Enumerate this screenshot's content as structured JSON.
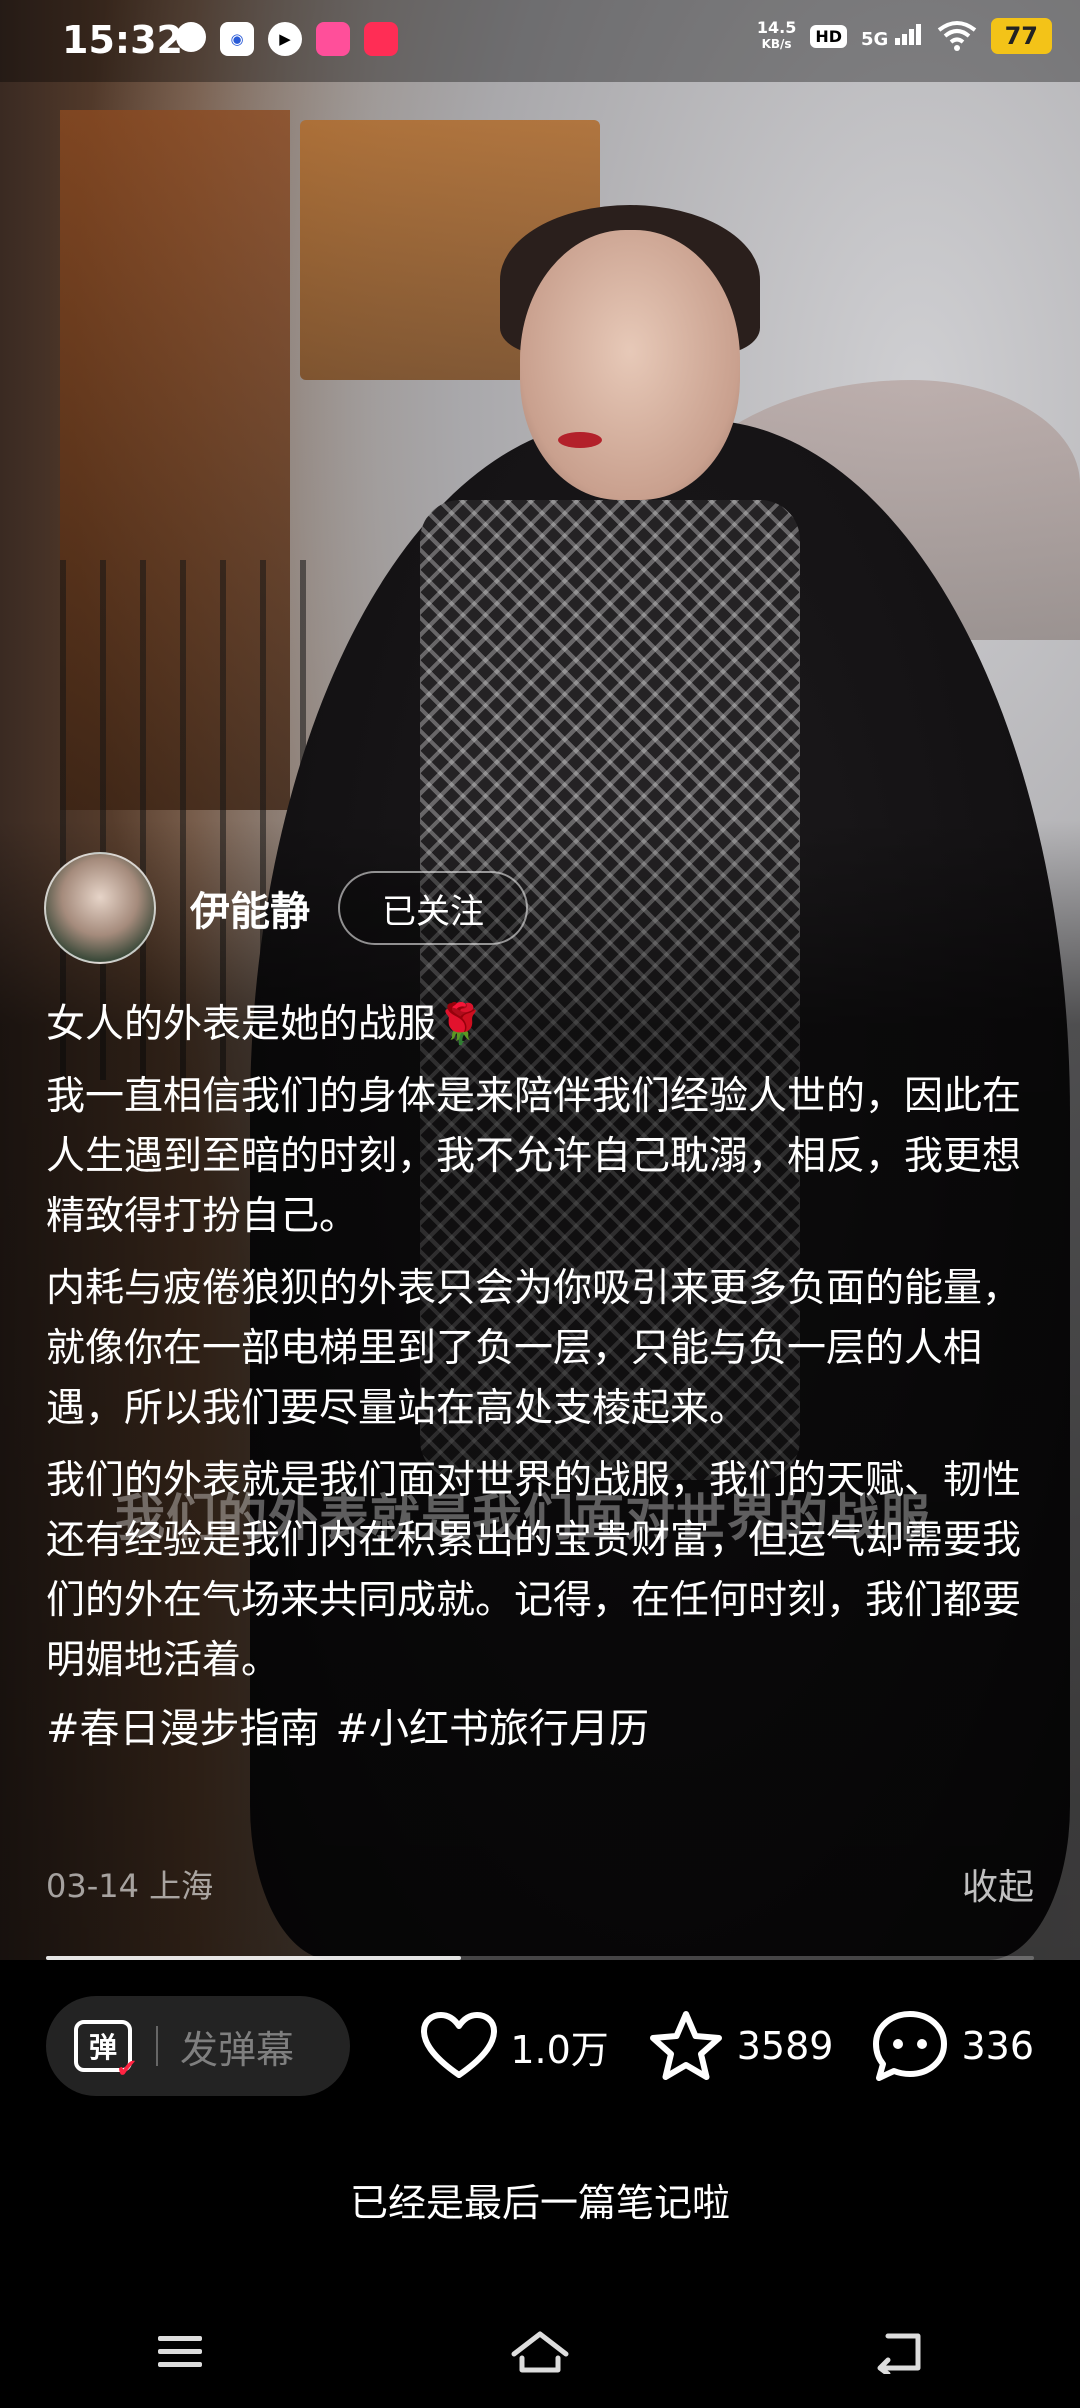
{
  "status_bar": {
    "time": "15:32",
    "net_speed_value": "14.5",
    "net_speed_unit": "KB/s",
    "hd": "HD",
    "network": "5G",
    "battery": "77"
  },
  "author": {
    "name": "伊能静",
    "follow_label": "已关注"
  },
  "caption": {
    "paragraphs": [
      "女人的外表是她的战服",
      "我一直相信我们的身体是来陪伴我们经验人世的，因此在人生遇到至暗的时刻，我不允许自己耽溺，相反，我更想精致得打扮自己。",
      "内耗与疲倦狼狈的外表只会为你吸引来更多负面的能量，就像你在一部电梯里到了负一层，只能与负一层的人相遇，所以我们要尽量站在高处支棱起来。",
      "我们的外表就是我们面对世界的战服，我们的天赋、韧性还有经验是我们内在积累出的宝贵财富，但运气却需要我们的外在气场来共同成就。记得，在任何时刻，我们都要明媚地活着。"
    ],
    "rose": "🌹",
    "tags": [
      "#春日漫步指南",
      "#小红书旅行月历"
    ]
  },
  "watermark": "我们的外表就是我们面对世界的战服",
  "meta": {
    "date_location": "03-14 上海",
    "collapse_label": "收起"
  },
  "progress": {
    "fraction": 0.42
  },
  "bottom_bar": {
    "danmu_icon_char": "弹",
    "danmu_placeholder": "发弹幕",
    "likes": "1.0万",
    "collects": "3589",
    "comments": "336"
  },
  "end_message": "已经是最后一篇笔记啦",
  "colors": {
    "accent": "#ff2442",
    "battery": "#f3c318"
  },
  "icons": {
    "like": "heart-icon",
    "collect": "star-icon",
    "comment": "comment-bubble-icon",
    "nav_menu": "menu-icon",
    "nav_home": "home-icon",
    "nav_back": "back-icon"
  }
}
